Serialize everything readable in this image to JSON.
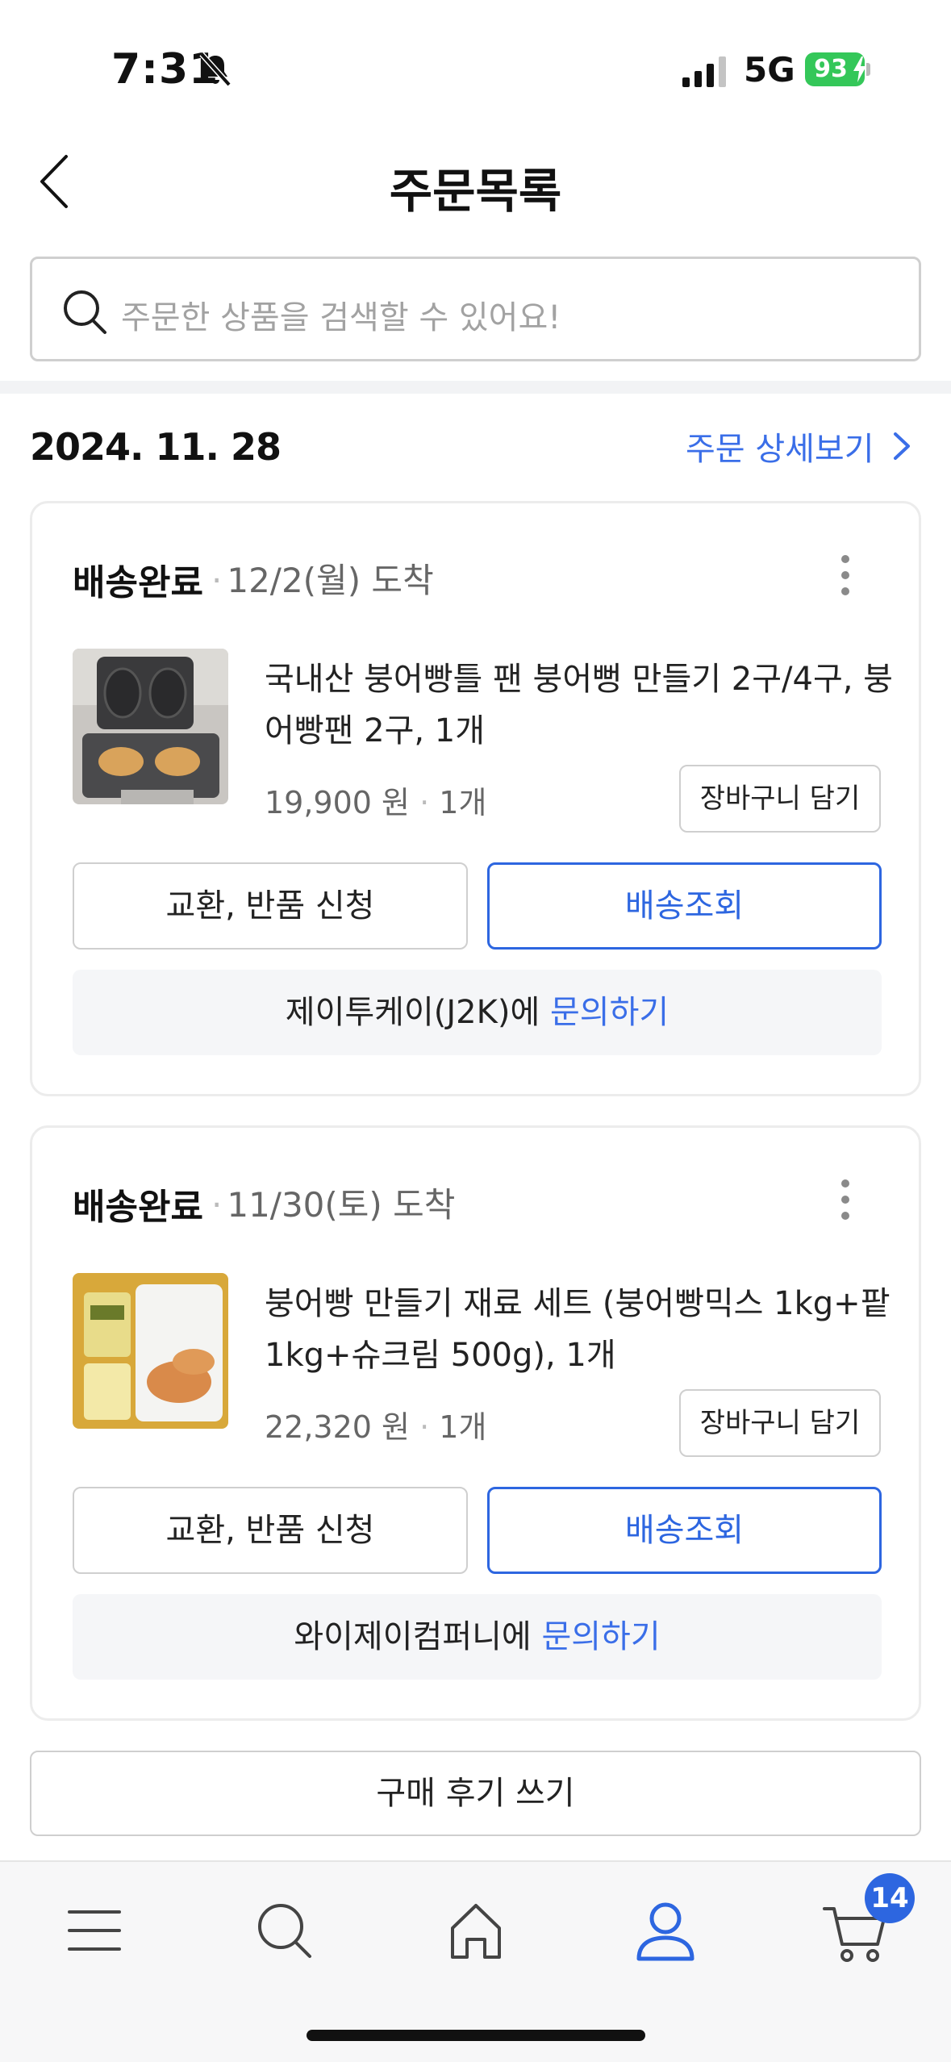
{
  "status_bar": {
    "time": "7:31",
    "network": "5G",
    "battery": "93"
  },
  "header": {
    "title": "주문목록"
  },
  "search": {
    "placeholder": "주문한 상품을 검색할 수 있어요!"
  },
  "order": {
    "date": "2024. 11. 28",
    "detail_link": "주문 상세보기"
  },
  "cards": [
    {
      "status": "배송완료",
      "eta": "12/2(월) 도착",
      "product_name": "국내산 붕어빵틀 팬 붕어뻥 만들기 2구/4구, 붕어빵팬 2구, 1개",
      "price": "19,900 원",
      "quantity": "1개",
      "cart_button": "장바구니 담기",
      "exchange_button": "교환, 반품 신청",
      "track_button": "배송조회",
      "seller": "제이투케이(J2K)에",
      "inquiry_link": "문의하기"
    },
    {
      "status": "배송완료",
      "eta": "11/30(토) 도착",
      "product_name": "붕어빵 만들기 재료 세트 (붕어빵믹스 1kg+팥 1kg+슈크림 500g), 1개",
      "price": "22,320 원",
      "quantity": "1개",
      "cart_button": "장바구니 담기",
      "exchange_button": "교환, 반품 신청",
      "track_button": "배송조회",
      "seller": "와이제이컴퍼니에",
      "inquiry_link": "문의하기"
    }
  ],
  "review_button": "구매 후기 쓰기",
  "bottom_nav": {
    "items": [
      "menu-icon",
      "search-icon",
      "home-icon",
      "user-icon",
      "cart-icon"
    ],
    "cart_badge": "14"
  },
  "colors": {
    "accent": "#2d66e0",
    "link": "#3a6ee8",
    "battery": "#34c759"
  }
}
